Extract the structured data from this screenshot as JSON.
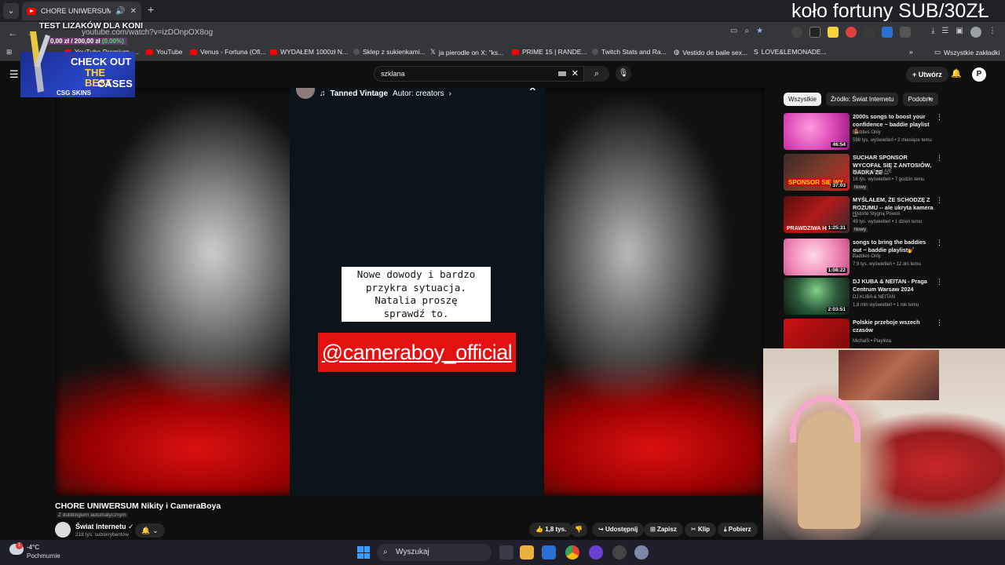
{
  "browser": {
    "tab_title": "CHORE UNIWERSUM Nikity",
    "url": "youtube.com/watch?v=izDOnpOX8og",
    "bookmarks": [
      "YouTube Premium -...",
      "YouTube",
      "Venus - Fortuna (Ofi...",
      "WYDAŁEM 1000zł N...",
      "Sklep z sukienkami...",
      "ja pierodle on X: \"ks...",
      "PRIME 15 | RANDE...",
      "Twitch Stats and Ra...",
      "Vestido de baile sex...",
      "LOVE&LEMONADE..."
    ],
    "all_bookmarks": "Wszystkie zakładki"
  },
  "overlay": {
    "wheel": "koło fortuny SUB/30ZŁ",
    "lizak_title": "TEST LIZAKÓW DLA KONI",
    "lizak_progress": "0,00 zł / 200,00 zł",
    "lizak_percent": "(0.00%)",
    "csg_line1": "CHECK OUT",
    "csg_line2": "THE BEST",
    "csg_line3": "CASES",
    "csg_brand": "CSG SKINS"
  },
  "youtube": {
    "search_query": "szklana",
    "create_label": "Utwórz",
    "short": {
      "music_label": "Tanned Vintage",
      "author": "Autor: creators",
      "note_lines": [
        "Nowe dowody i bardzo",
        "przykra sytuacja.",
        "Natalia proszę",
        "sprawdź to."
      ],
      "handle": "@cameraboy_official"
    },
    "video_title": "CHORE UNIWERSUM Nikity i CameraBoya",
    "dubbing": "Z dubbingiem automatycznym",
    "channel_name": "Świat Internetu",
    "subscribers": "218 tys. subskrybentów",
    "actions": {
      "likes": "1,8 tys.",
      "share": "Udostępnij",
      "save": "Zapisz",
      "clip": "Klip",
      "download": "Pobierz"
    },
    "chips": [
      "Wszystkie",
      "Źródło: Świat Internetu",
      "Podobne"
    ],
    "recommendations": [
      {
        "title": "2000s songs to boost your confidence ~ baddie playlist 💄",
        "channel": "Baddies Only",
        "meta": "598 tys. wyświetleń • 2 miesiące temu",
        "duration": "46:54",
        "badge": ""
      },
      {
        "title": "SUCHAR SPONSOR WYCOFAŁ SIĘ Z ANTOSIÓW, GADKA ZE ...",
        "channel": "MokrySuchar LIVE",
        "meta": "16 tys. wyświetleń • 7 godzin temu",
        "duration": "37:03",
        "badge": "Nowy"
      },
      {
        "title": "MYŚLAŁEM, ŻE SCHODZĘ Z ROZUMU -- ale ukryta kamera ...",
        "channel": "Historie Stygną Powoli",
        "meta": "49 tys. wyświetleń • 1 dzień temu",
        "duration": "1:25:31",
        "badge": "Nowy"
      },
      {
        "title": "songs to bring the baddies out ~ baddie playlist💅",
        "channel": "Baddies Only",
        "meta": "7,9 tys. wyświetleń • 12 dni temu",
        "duration": "1:08:22",
        "badge": ""
      },
      {
        "title": "DJ KUBA & NEITAN - Praga Centrum Warsaw 2024",
        "channel": "DJ KUBA & NEITAN",
        "meta": "1,8 mln wyświetleń • 1 rok temu",
        "duration": "2:03:51",
        "badge": ""
      },
      {
        "title": "Polskie przeboje wszech czasów",
        "channel": "MichalS • Playlista",
        "meta": "",
        "duration": "",
        "badge": ""
      }
    ]
  },
  "taskbar": {
    "temperature": "-4°C",
    "weather": "Pochmurnie",
    "search_label": "Wyszukaj"
  }
}
